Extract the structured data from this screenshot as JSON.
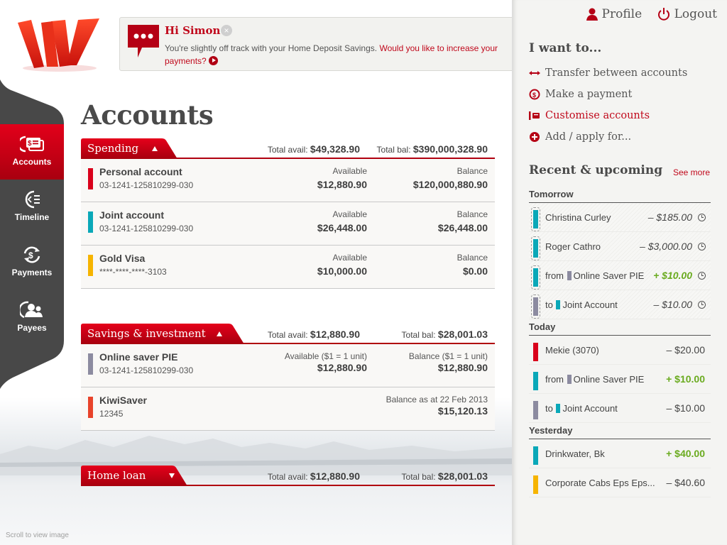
{
  "colors": {
    "brand_red": "#d5001c",
    "dark_red": "#b0000f",
    "sidebar_bg": "#484848",
    "positive_green": "#6aab1f",
    "acct_red": "#d9001b",
    "acct_teal": "#0aa8b8",
    "acct_gold": "#f6b400",
    "acct_slate": "#8c8ba0",
    "acct_orange": "#e8432a"
  },
  "sidebar": {
    "items": [
      {
        "label": "Accounts",
        "icon": "accounts-icon",
        "active": true
      },
      {
        "label": "Timeline",
        "icon": "timeline-icon",
        "active": false
      },
      {
        "label": "Payments",
        "icon": "payments-icon",
        "active": false
      },
      {
        "label": "Payees",
        "icon": "payees-icon",
        "active": false
      }
    ]
  },
  "notice": {
    "greeting": "Hi Simon",
    "message": "You're slightly off track with your Home Deposit Savings.",
    "link": "Would you like to increase your payments?"
  },
  "main": {
    "title": "Accounts",
    "groups": [
      {
        "label": "Spending",
        "expanded": true,
        "total_avail_label": "Total avail:",
        "total_avail": "$49,328.90",
        "total_bal_label": "Total bal:",
        "total_bal": "$390,000,328.90",
        "accounts": [
          {
            "name": "Personal account",
            "number": "03-1241-125810299-030",
            "avail_label": "Available",
            "avail": "$12,880.90",
            "bal_label": "Balance",
            "bal": "$120,000,880.90",
            "color": "#d9001b"
          },
          {
            "name": "Joint account",
            "number": "03-1241-125810299-030",
            "avail_label": "Available",
            "avail": "$26,448.00",
            "bal_label": "Balance",
            "bal": "$26,448.00",
            "color": "#0aa8b8"
          },
          {
            "name": "Gold Visa",
            "number": "****-****-****-3103",
            "avail_label": "Available",
            "avail": "$10,000.00",
            "bal_label": "Balance",
            "bal": "$0.00",
            "color": "#f6b400"
          }
        ]
      },
      {
        "label": "Savings & investment",
        "expanded": true,
        "total_avail_label": "Total avail:",
        "total_avail": "$12,880.90",
        "total_bal_label": "Total bal:",
        "total_bal": "$28,001.03",
        "accounts": [
          {
            "name": "Online saver PIE",
            "number": "03-1241-125810299-030",
            "avail_label": "Available ($1 = 1 unit)",
            "avail": "$12,880.90",
            "bal_label": "Balance ($1 = 1 unit)",
            "bal": "$12,880.90",
            "color": "#8c8ba0"
          },
          {
            "name": "KiwiSaver",
            "number": "12345",
            "avail_label": "",
            "avail": "",
            "bal_label": "Balance as at 22 Feb 2013",
            "bal": "$15,120.13",
            "color": "#e8432a"
          }
        ]
      },
      {
        "label": "Home loan",
        "expanded": false,
        "total_avail_label": "Total avail:",
        "total_avail": "$12,880.90",
        "total_bal_label": "Total bal:",
        "total_bal": "$28,001.03",
        "accounts": []
      }
    ],
    "scroll_hint": "Scroll to view image"
  },
  "right": {
    "profile": "Profile",
    "logout": "Logout",
    "iwant_title": "I want to...",
    "actions": [
      {
        "label": "Transfer between accounts",
        "icon": "transfer-icon"
      },
      {
        "label": "Make a payment",
        "icon": "payment-icon"
      },
      {
        "label": "Customise accounts",
        "icon": "customise-icon",
        "hover": true
      },
      {
        "label": "Add / apply for...",
        "icon": "add-icon"
      }
    ],
    "recent_title": "Recent & upcoming",
    "see_more": "See more",
    "days": [
      {
        "label": "Tomorrow",
        "pending": true,
        "items": [
          {
            "prefix": "",
            "mini_color": "",
            "desc": "Christina Curley",
            "amount": "– $185.00",
            "positive": false,
            "color": "#0aa8b8"
          },
          {
            "prefix": "",
            "mini_color": "",
            "desc": "Roger Cathro",
            "amount": "– $3,000.00",
            "positive": false,
            "color": "#0aa8b8"
          },
          {
            "prefix": "from",
            "mini_color": "#8c8ba0",
            "desc": "Online Saver PIE",
            "amount": "+ $10.00",
            "positive": true,
            "color": "#0aa8b8"
          },
          {
            "prefix": "to",
            "mini_color": "#0aa8b8",
            "desc": "Joint Account",
            "amount": "– $10.00",
            "positive": false,
            "color": "#8c8ba0"
          }
        ]
      },
      {
        "label": "Today",
        "pending": false,
        "items": [
          {
            "prefix": "",
            "mini_color": "",
            "desc": "Mekie (3070)",
            "amount": "– $20.00",
            "positive": false,
            "color": "#d9001b"
          },
          {
            "prefix": "from",
            "mini_color": "#8c8ba0",
            "desc": "Online Saver PIE",
            "amount": "+ $10.00",
            "positive": true,
            "color": "#0aa8b8"
          },
          {
            "prefix": "to",
            "mini_color": "#0aa8b8",
            "desc": "Joint Account",
            "amount": "– $10.00",
            "positive": false,
            "color": "#8c8ba0"
          }
        ]
      },
      {
        "label": "Yesterday",
        "pending": false,
        "items": [
          {
            "prefix": "",
            "mini_color": "",
            "desc": "Drinkwater, Bk",
            "amount": "+ $40.00",
            "positive": true,
            "color": "#0aa8b8"
          },
          {
            "prefix": "",
            "mini_color": "",
            "desc": "Corporate Cabs Eps Eps...",
            "amount": "– $40.60",
            "positive": false,
            "color": "#f6b400"
          }
        ]
      }
    ]
  }
}
